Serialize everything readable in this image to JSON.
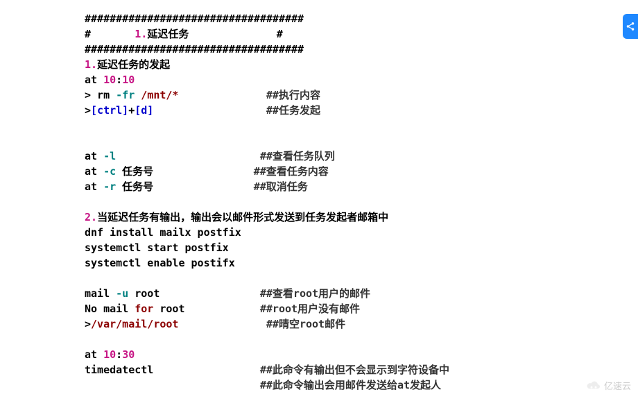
{
  "watermark": "亿速云",
  "lines": [
    {
      "segments": [
        {
          "text": "###################################",
          "cls": "c-black"
        }
      ]
    },
    {
      "segments": [
        {
          "text": "#       ",
          "cls": "c-black"
        },
        {
          "text": "1.",
          "cls": "c-magenta"
        },
        {
          "text": "延迟任务              #",
          "cls": "c-black"
        }
      ]
    },
    {
      "segments": [
        {
          "text": "###################################",
          "cls": "c-black"
        }
      ]
    },
    {
      "segments": [
        {
          "text": "1.",
          "cls": "c-magenta"
        },
        {
          "text": "延迟任务的发起",
          "cls": "c-black"
        }
      ]
    },
    {
      "segments": [
        {
          "text": "at ",
          "cls": "c-black"
        },
        {
          "text": "10",
          "cls": "c-magenta"
        },
        {
          "text": ":",
          "cls": "c-black"
        },
        {
          "text": "10",
          "cls": "c-magenta"
        }
      ]
    },
    {
      "segments": [
        {
          "text": "> rm ",
          "cls": "c-black"
        },
        {
          "text": "-fr",
          "cls": "c-teal"
        },
        {
          "text": " ",
          "cls": "c-black"
        },
        {
          "text": "/mnt/*",
          "cls": "c-reddish"
        },
        {
          "text": "              ",
          "cls": "c-black"
        },
        {
          "text": "##执行内容",
          "cls": "c-slate"
        }
      ]
    },
    {
      "segments": [
        {
          "text": ">",
          "cls": "c-black"
        },
        {
          "text": "[ctrl]",
          "cls": "c-blue"
        },
        {
          "text": "+",
          "cls": "c-black"
        },
        {
          "text": "[d]",
          "cls": "c-blue"
        },
        {
          "text": "                  ",
          "cls": "c-black"
        },
        {
          "text": "##任务发起",
          "cls": "c-slate"
        }
      ]
    },
    {
      "segments": [
        {
          "text": " ",
          "cls": "c-black"
        }
      ]
    },
    {
      "segments": [
        {
          "text": " ",
          "cls": "c-black"
        }
      ]
    },
    {
      "segments": [
        {
          "text": "at ",
          "cls": "c-black"
        },
        {
          "text": "-l",
          "cls": "c-teal"
        },
        {
          "text": "                       ",
          "cls": "c-black"
        },
        {
          "text": "##查看任务队列",
          "cls": "c-slate"
        }
      ]
    },
    {
      "segments": [
        {
          "text": "at ",
          "cls": "c-black"
        },
        {
          "text": "-c",
          "cls": "c-teal"
        },
        {
          "text": " 任务号                ",
          "cls": "c-black"
        },
        {
          "text": "##查看任务内容",
          "cls": "c-slate"
        }
      ]
    },
    {
      "segments": [
        {
          "text": "at ",
          "cls": "c-black"
        },
        {
          "text": "-r",
          "cls": "c-teal"
        },
        {
          "text": " 任务号                ",
          "cls": "c-black"
        },
        {
          "text": "##取消任务",
          "cls": "c-slate"
        }
      ]
    },
    {
      "segments": [
        {
          "text": " ",
          "cls": "c-black"
        }
      ]
    },
    {
      "segments": [
        {
          "text": "2.",
          "cls": "c-magenta"
        },
        {
          "text": "当延迟任务有输出，输出会以邮件形式发送到任务发起者邮箱中",
          "cls": "c-black"
        }
      ]
    },
    {
      "segments": [
        {
          "text": "dnf install mailx postfix",
          "cls": "c-black"
        }
      ]
    },
    {
      "segments": [
        {
          "text": "systemctl start postfix",
          "cls": "c-black"
        }
      ]
    },
    {
      "segments": [
        {
          "text": "systemctl enable postifx",
          "cls": "c-black"
        }
      ]
    },
    {
      "segments": [
        {
          "text": " ",
          "cls": "c-black"
        }
      ]
    },
    {
      "segments": [
        {
          "text": "mail ",
          "cls": "c-black"
        },
        {
          "text": "-u",
          "cls": "c-teal"
        },
        {
          "text": " root                ",
          "cls": "c-black"
        },
        {
          "text": "##查看root用户的邮件",
          "cls": "c-slate"
        }
      ]
    },
    {
      "segments": [
        {
          "text": "No mail ",
          "cls": "c-black"
        },
        {
          "text": "for",
          "cls": "c-reddish"
        },
        {
          "text": " root            ",
          "cls": "c-black"
        },
        {
          "text": "##root用户没有邮件",
          "cls": "c-slate"
        }
      ]
    },
    {
      "segments": [
        {
          "text": ">",
          "cls": "c-black"
        },
        {
          "text": "/var/mail/root",
          "cls": "c-reddish"
        },
        {
          "text": "              ",
          "cls": "c-black"
        },
        {
          "text": "##晴空root邮件",
          "cls": "c-slate"
        }
      ]
    },
    {
      "segments": [
        {
          "text": " ",
          "cls": "c-black"
        }
      ]
    },
    {
      "segments": [
        {
          "text": "at ",
          "cls": "c-black"
        },
        {
          "text": "10",
          "cls": "c-magenta"
        },
        {
          "text": ":",
          "cls": "c-black"
        },
        {
          "text": "30",
          "cls": "c-magenta"
        }
      ]
    },
    {
      "segments": [
        {
          "text": "timedatectl                 ",
          "cls": "c-black"
        },
        {
          "text": "##此命令有输出但不会显示到字符设备中",
          "cls": "c-slate"
        }
      ]
    },
    {
      "segments": [
        {
          "text": "                            ",
          "cls": "c-black"
        },
        {
          "text": "##此命令输出会用邮件发送给at发起人",
          "cls": "c-slate"
        }
      ]
    }
  ]
}
